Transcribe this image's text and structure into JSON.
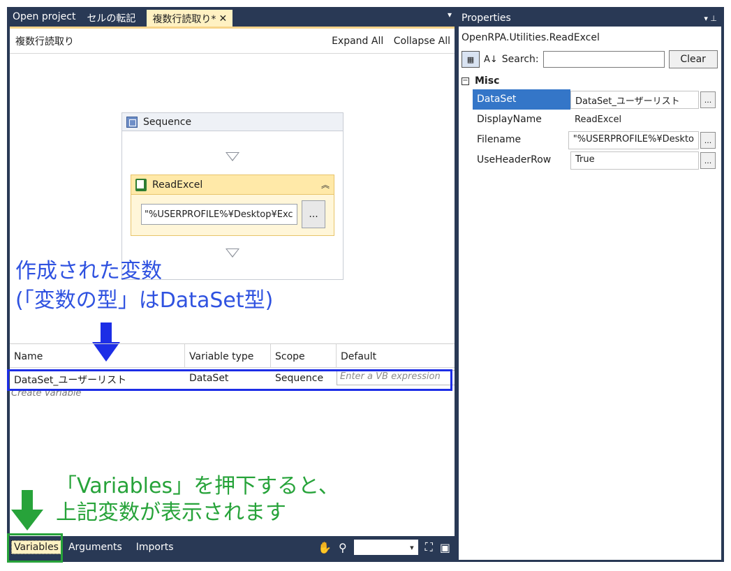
{
  "tabs": [
    {
      "label": "Open project"
    },
    {
      "label": "セルの転記"
    },
    {
      "label": "複数行読取り*"
    }
  ],
  "designer": {
    "breadcrumb": "複数行読取り",
    "expand_all": "Expand All",
    "collapse_all": "Collapse All",
    "sequence_title": "Sequence",
    "readexcel_title": "ReadExcel",
    "readexcel_input": "\"%USERPROFILE%¥Desktop¥Exc",
    "dots": "..."
  },
  "annotations": {
    "blue_line1": "作成された変数",
    "blue_line2": "(「変数の型」はDataSet型)",
    "green_line1": "「Variables」を押下すると、",
    "green_line2": "上記変数が表示されます"
  },
  "variables": {
    "headers": [
      "Name",
      "Variable type",
      "Scope",
      "Default"
    ],
    "row": {
      "name": "DataSet_ユーザーリスト",
      "type": "DataSet",
      "scope": "Sequence",
      "default_placeholder": "Enter a VB expression"
    },
    "create": "Create Variable"
  },
  "bottombar": {
    "variables": "Variables",
    "arguments": "Arguments",
    "imports": "Imports"
  },
  "properties": {
    "title": "Properties",
    "type": "OpenRPA.Utilities.ReadExcel",
    "search_label": "Search:",
    "clear": "Clear",
    "category": "Misc",
    "rows": [
      {
        "name": "DataSet",
        "value": "DataSet_ユーザーリスト"
      },
      {
        "name": "DisplayName",
        "value": "ReadExcel"
      },
      {
        "name": "Filename",
        "value": "\"%USERPROFILE%¥Deskto"
      },
      {
        "name": "UseHeaderRow",
        "value": "True"
      }
    ]
  },
  "colors": {
    "chrome": "#293955",
    "active_tab": "#fff1c2",
    "note_blue": "#2f52e0",
    "note_green": "#27a33a"
  }
}
